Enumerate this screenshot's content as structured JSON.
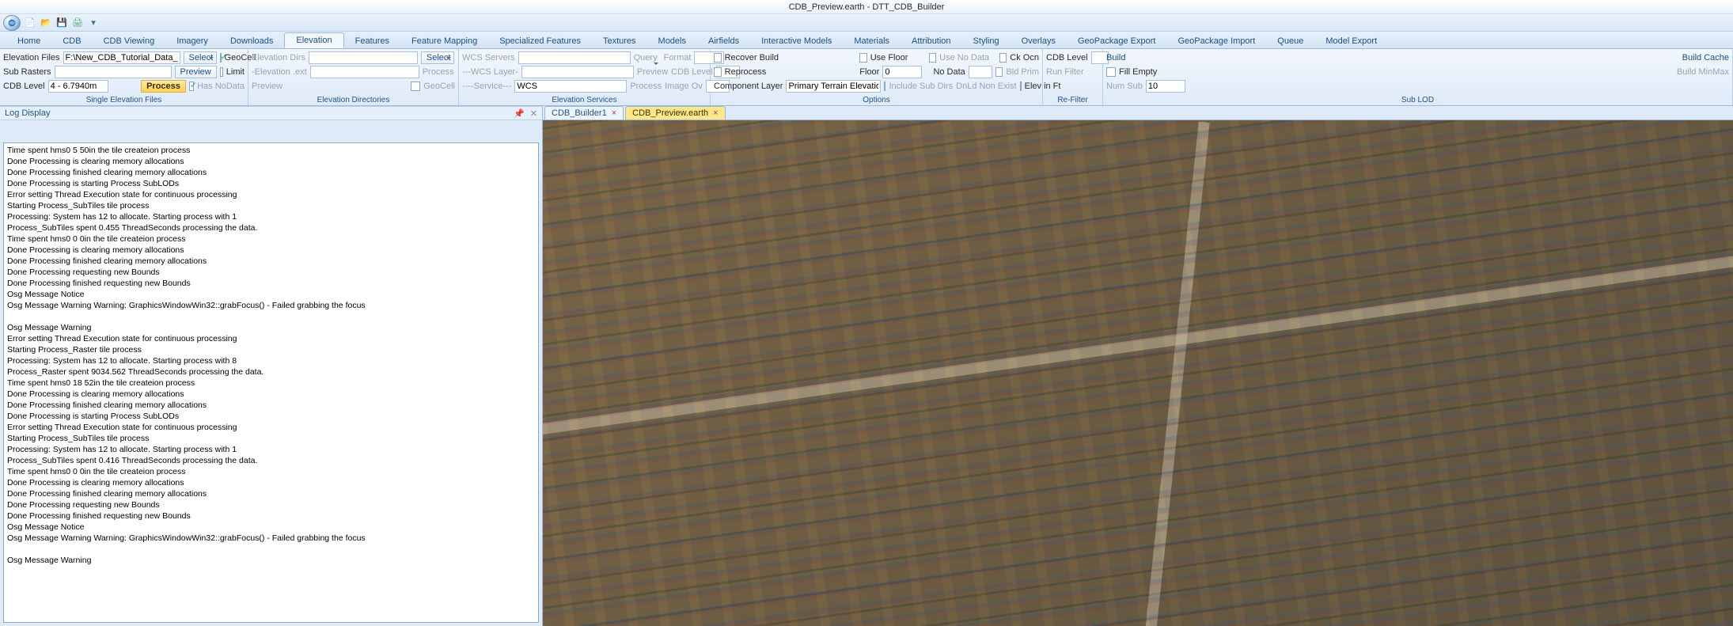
{
  "window_title": "CDB_Preview.earth - DTT_CDB_Builder",
  "tabs": [
    "Home",
    "CDB",
    "CDB Viewing",
    "Imagery",
    "Downloads",
    "Elevation",
    "Features",
    "Feature Mapping",
    "Specialized Features",
    "Textures",
    "Models",
    "Airfields",
    "Interactive Models",
    "Materials",
    "Attribution",
    "Styling",
    "Overlays",
    "GeoPackage Export",
    "GeoPackage Import",
    "Queue",
    "Model Export"
  ],
  "active_tab": "Elevation",
  "groups": {
    "single": {
      "title": "Single Elevation Files",
      "elevation_files_label": "Elevation Files",
      "elevation_files_value": "F:\\New_CDB_Tutorial_Data_LongBeach",
      "select_label": "Select",
      "geocell_label": "GeoCell",
      "geocell_checked": true,
      "sub_rasters_label": "Sub Rasters",
      "sub_rasters_value": "",
      "preview_label": "Preview",
      "limit_label": "Limit",
      "cdb_level_label": "CDB Level",
      "cdb_level_value": "4 - 6.7940m",
      "process_label": "Process",
      "has_nodata_label": "Has NoData"
    },
    "dirs": {
      "title": "Elevation Directories",
      "elevation_dirs_label": "Elevation Dirs",
      "elevation_ext_label": "-Elevation .ext",
      "select_label": "Select",
      "process_label": "Process",
      "preview_label": "Preview",
      "geocell_label": "GeoCell"
    },
    "services": {
      "title": "Elevation Services",
      "wcs_servers_label": "WCS Servers",
      "wcs_layer_label": "---WCS Layer-",
      "service_label": "----Service---",
      "service_value": "WCS",
      "query_label": "Query",
      "format_label": "Format",
      "preview_label": "Preview",
      "cdb_level_label": "CDB Level",
      "process_label": "Process",
      "image_ov_label": "Image Ov"
    },
    "options": {
      "title": "Options",
      "recover_build_label": "Recover Build",
      "reprocess_label": "Reprocess",
      "component_layer_label": "Component Layer",
      "component_layer_value": "Primary Terrain Elevation",
      "use_floor_label": "Use Floor",
      "floor_label": "Floor",
      "floor_value": "0",
      "include_sub_dirs_label": "Include Sub Dirs",
      "use_no_data_label": "Use No Data",
      "no_data_label": "No Data",
      "dnld_non_exist_label": "DnLd Non Exist",
      "ck_ocn_label": "Ck Ocn",
      "bld_prim_label": "Bld Prim",
      "elev_in_ft_label": "Elev in Ft"
    },
    "refilter": {
      "title": "Re-Filter",
      "cdb_level_label": "CDB Level",
      "run_filter_label": "Run Filter"
    },
    "sublod": {
      "title": "Sub LOD",
      "build_label": "Build",
      "build_cache_label": "Build Cache",
      "fill_empty_label": "Fill Empty",
      "build_minmax_label": "Build MinMax",
      "num_sub_label": "Num Sub",
      "num_sub_value": "10"
    }
  },
  "log_panel_title": "Log Display",
  "log_lines": [
    "Time spent hms0 5 50in the tile createion process",
    "Done Processing is clearing memory allocations",
    "Done Processing finished clearing memory allocations",
    "Done Processing is starting Process SubLODs",
    "Error setting Thread Execution state for continuous processing",
    "Starting Process_SubTiles tile process",
    "Processing: System has 12 to allocate. Starting process with 1",
    "Process_SubTiles spent 0.455 ThreadSeconds processing the data.",
    "Time spent hms0 0 0in the tile createion process",
    "Done Processing is clearing memory allocations",
    "Done Processing finished clearing memory allocations",
    "Done Processing requesting new Bounds",
    "Done Processing finished requesting new Bounds",
    "Osg Message Notice",
    "Osg Message Warning Warning: GraphicsWindowWin32::grabFocus() - Failed grabbing the focus",
    "",
    "Osg Message Warning",
    "Error setting Thread Execution state for continuous processing",
    "Starting Process_Raster tile process",
    "Processing: System has 12 to allocate. Starting process with 8",
    "Process_Raster spent 9034.562 ThreadSeconds processing the data.",
    "Time spent hms0 18 52in the tile createion process",
    "Done Processing is clearing memory allocations",
    "Done Processing finished clearing memory allocations",
    "Done Processing is starting Process SubLODs",
    "Error setting Thread Execution state for continuous processing",
    "Starting Process_SubTiles tile process",
    "Processing: System has 12 to allocate. Starting process with 1",
    "Process_SubTiles spent 0.416 ThreadSeconds processing the data.",
    "Time spent hms0 0 0in the tile createion process",
    "Done Processing is clearing memory allocations",
    "Done Processing finished clearing memory allocations",
    "Done Processing requesting new Bounds",
    "Done Processing finished requesting new Bounds",
    "Osg Message Notice",
    "Osg Message Warning Warning: GraphicsWindowWin32::grabFocus() - Failed grabbing the focus",
    "",
    "Osg Message Warning"
  ],
  "doc_tabs": [
    {
      "label": "CDB_Builder1",
      "active": false
    },
    {
      "label": "CDB_Preview.earth",
      "active": true
    }
  ]
}
